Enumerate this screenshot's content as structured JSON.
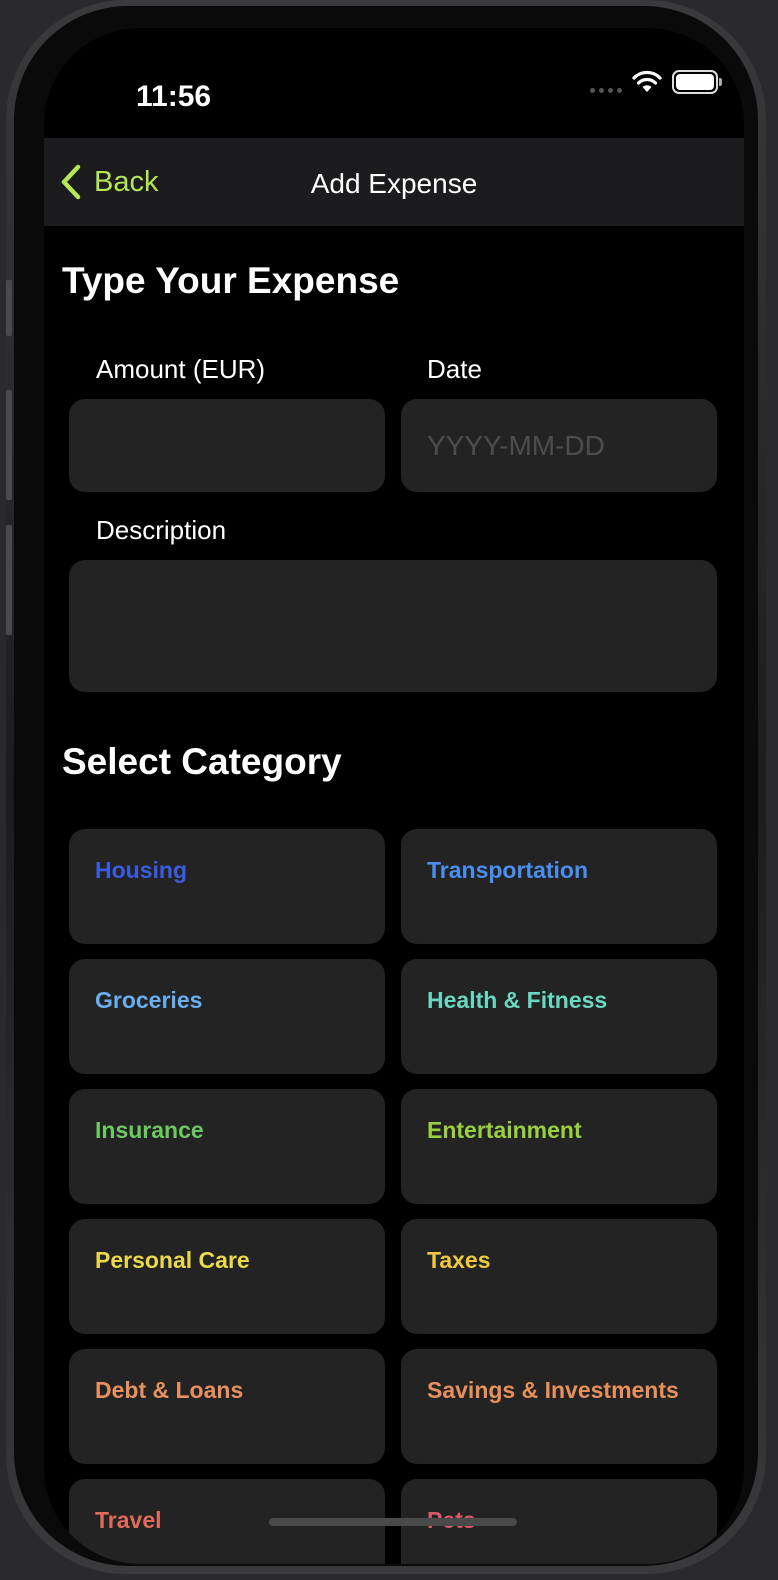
{
  "status_bar": {
    "time": "11:56"
  },
  "nav": {
    "back_label": "Back",
    "title": "Add Expense",
    "accent_color": "#b5e655"
  },
  "form": {
    "section_title": "Type Your Expense",
    "amount_label": "Amount (EUR)",
    "amount_value": "",
    "date_label": "Date",
    "date_placeholder": "YYYY-MM-DD",
    "description_label": "Description",
    "description_value": ""
  },
  "categories": {
    "section_title": "Select Category",
    "items": [
      {
        "label": "Housing",
        "color": "#3a5ce0"
      },
      {
        "label": "Transportation",
        "color": "#4a8ef0"
      },
      {
        "label": "Groceries",
        "color": "#6aaef0"
      },
      {
        "label": "Health & Fitness",
        "color": "#6ad8c0"
      },
      {
        "label": "Insurance",
        "color": "#6cc860"
      },
      {
        "label": "Entertainment",
        "color": "#9ad040"
      },
      {
        "label": "Personal Care",
        "color": "#ecd84c"
      },
      {
        "label": "Taxes",
        "color": "#f0c840"
      },
      {
        "label": "Debt & Loans",
        "color": "#e89060"
      },
      {
        "label": "Savings & Investments",
        "color": "#e8905c"
      },
      {
        "label": "Travel",
        "color": "#e06a5c"
      },
      {
        "label": "Pets",
        "color": "#d85a6a"
      }
    ]
  },
  "icons": {
    "back": "chevron-left-icon",
    "wifi": "wifi-icon",
    "battery": "battery-icon",
    "signal": "cellular-signal-icon"
  }
}
